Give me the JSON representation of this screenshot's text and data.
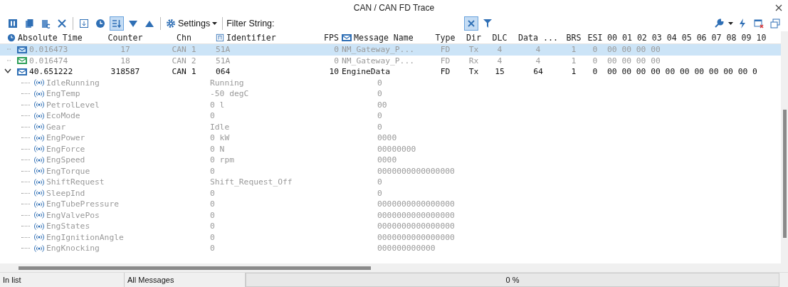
{
  "window": {
    "title": "CAN / CAN FD Trace"
  },
  "toolbar": {
    "groups": [
      [
        {
          "kind": "pause",
          "on": false
        },
        {
          "kind": "copy",
          "on": false
        },
        {
          "kind": "copy-c",
          "on": false
        },
        {
          "kind": "delete",
          "on": false
        }
      ],
      [
        {
          "kind": "download",
          "on": false
        },
        {
          "kind": "clock",
          "on": false
        },
        {
          "kind": "sort",
          "on": true
        },
        {
          "kind": "down",
          "on": false
        },
        {
          "kind": "up",
          "on": false
        }
      ]
    ],
    "settings_label": "Settings",
    "filter_label": "Filter String:"
  },
  "columns": [
    {
      "label": "Absolute Time",
      "kind": "time"
    },
    {
      "label": "Counter",
      "kind": "text"
    },
    {
      "label": "Chn",
      "kind": "text"
    },
    {
      "label": "Identifier",
      "kind": "id"
    },
    {
      "label": "FPS",
      "kind": "text"
    },
    {
      "label": "Message Name",
      "kind": "msg"
    },
    {
      "label": "Type",
      "kind": "text"
    },
    {
      "label": "Dir",
      "kind": "text"
    },
    {
      "label": "DLC",
      "kind": "text"
    },
    {
      "label": "Data ...",
      "kind": "text"
    },
    {
      "label": "BRS",
      "kind": "text"
    },
    {
      "label": "ESI",
      "kind": "text"
    },
    {
      "label": "00 01 02 03 04 05 06 07 08 09 10",
      "kind": "text"
    }
  ],
  "messages": [
    {
      "selected": true,
      "expanded": false,
      "dimmed": true,
      "color": "#2f6fb5",
      "cells": [
        "0.016473",
        "17",
        "CAN 1",
        "51A",
        "0",
        "NM_Gateway_P...",
        "FD",
        "Tx",
        "4",
        "4",
        "1",
        "0",
        "00 00 00 00"
      ]
    },
    {
      "selected": false,
      "expanded": false,
      "dimmed": true,
      "color": "#2fa05a",
      "cells": [
        "0.016474",
        "18",
        "CAN 2",
        "51A",
        "0",
        "NM_Gateway_P...",
        "FD",
        "Rx",
        "4",
        "4",
        "1",
        "0",
        "00 00 00 00"
      ]
    },
    {
      "selected": false,
      "expanded": true,
      "dimmed": false,
      "color": "#2f6fb5",
      "cells": [
        "40.651222",
        "318587",
        "CAN 1",
        "064",
        "10",
        "EngineData",
        "FD",
        "Tx",
        "15",
        "64",
        "1",
        "0",
        "00 00 00 00 00 00 00 00 00 00 0"
      ],
      "signals": [
        {
          "name": "IdleRunning",
          "value": "Running",
          "raw": "0"
        },
        {
          "name": "EngTemp",
          "value": "-50 degC",
          "raw": "0"
        },
        {
          "name": "PetrolLevel",
          "value": "0 l",
          "raw": "00"
        },
        {
          "name": "EcoMode",
          "value": "0",
          "raw": "0"
        },
        {
          "name": "Gear",
          "value": "Idle",
          "raw": "0"
        },
        {
          "name": "EngPower",
          "value": "0 kW",
          "raw": "0000"
        },
        {
          "name": "EngForce",
          "value": "0 N",
          "raw": "00000000"
        },
        {
          "name": "EngSpeed",
          "value": "0 rpm",
          "raw": "0000"
        },
        {
          "name": "EngTorque",
          "value": "0",
          "raw": "0000000000000000"
        },
        {
          "name": "ShiftRequest",
          "value": "Shift_Request_Off",
          "raw": "0"
        },
        {
          "name": "SleepInd",
          "value": "0",
          "raw": "0"
        },
        {
          "name": "EngTubePressure",
          "value": "0",
          "raw": "0000000000000000"
        },
        {
          "name": "EngValvePos",
          "value": "0",
          "raw": "0000000000000000"
        },
        {
          "name": "EngStates",
          "value": "0",
          "raw": "0000000000000000"
        },
        {
          "name": "EngIgnitionAngle",
          "value": "0",
          "raw": "0000000000000000"
        },
        {
          "name": "EngKnocking",
          "value": "0",
          "raw": "000000000000"
        }
      ]
    }
  ],
  "status_bar": {
    "in_list": "In list",
    "filter": "All Messages",
    "progress": {
      "label": "0 %",
      "level": 0
    }
  }
}
